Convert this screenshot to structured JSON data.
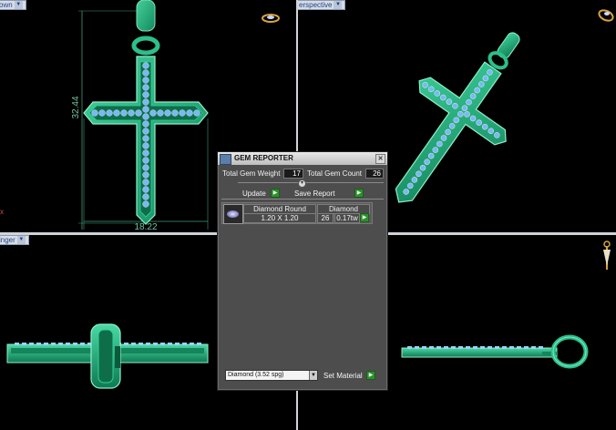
{
  "viewports": {
    "top_left": {
      "tab_label": "own"
    },
    "top_right": {
      "tab_label": "erspective"
    },
    "bottom_left": {
      "tab_label": "inger"
    },
    "bottom_right": {
      "tab_label": ""
    }
  },
  "dimensions": {
    "height": "32.44",
    "width": "18.22",
    "axis_marker": "x"
  },
  "gem_reporter": {
    "title": "GEM REPORTER",
    "total_weight_label": "Total Gem Weight",
    "total_weight_value": "17",
    "total_count_label": "Total Gem Count",
    "total_count_value": "26",
    "update_label": "Update",
    "save_report_label": "Save Report",
    "gems": [
      {
        "shape": "Diamond Round",
        "material": "Diamond",
        "size": "1.20 X 1.20",
        "count": "26",
        "weight": "0.17tw"
      }
    ],
    "material_select": "Diamond    (3.52 spg)",
    "set_material_label": "Set Material"
  },
  "colors": {
    "metal": "#1fa877",
    "metal_edge": "#7fe0bd",
    "gem": "#78b4f0",
    "panel_bg": "#4d4d4d"
  },
  "icons": [
    "close-icon",
    "app-icon",
    "play-icon",
    "chevron-down-icon",
    "ring-preview-icon"
  ]
}
